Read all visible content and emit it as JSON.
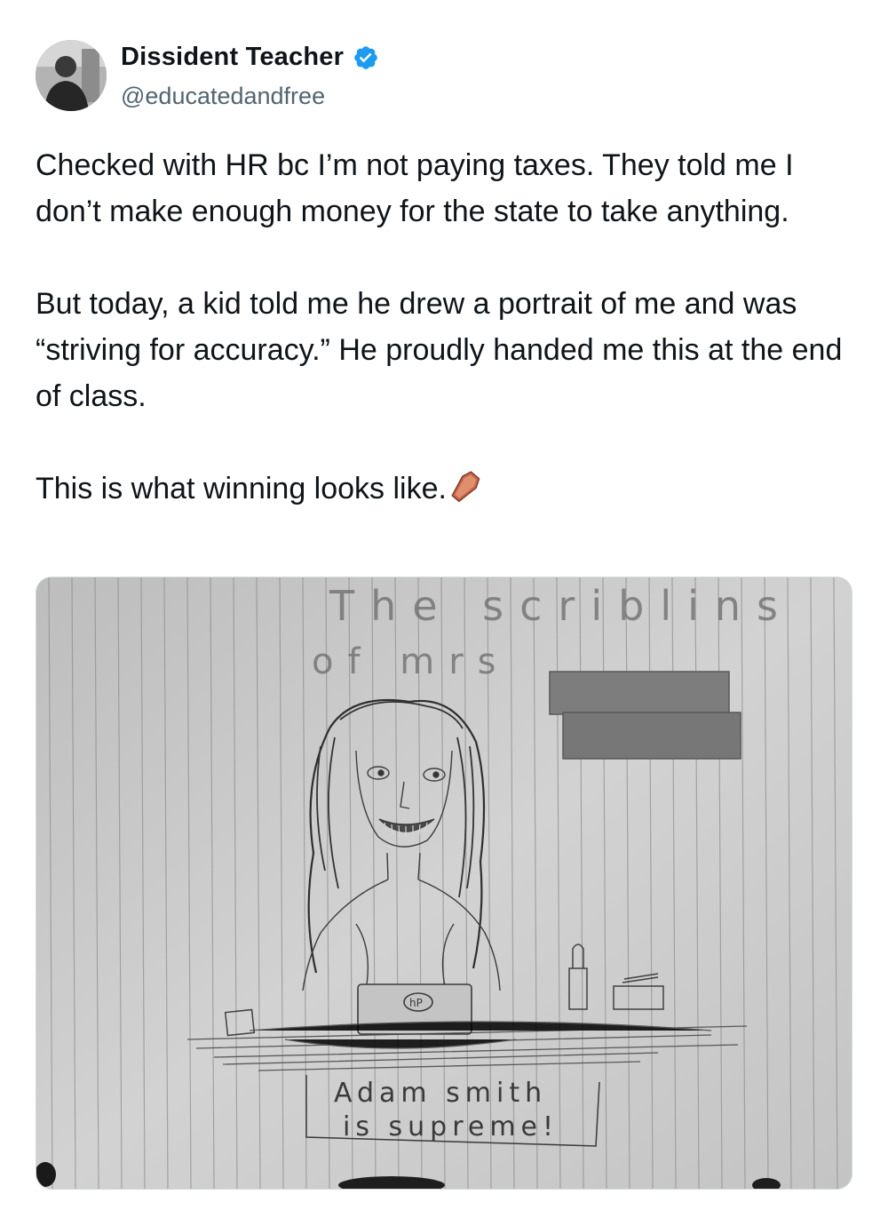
{
  "author": {
    "display_name": "Dissident Teacher",
    "handle": "@educatedandfree",
    "verified": true,
    "verified_color": "#1d9bf0"
  },
  "tweet": {
    "paragraphs": [
      "Checked with HR bc I’m not paying taxes. They told me I don’t make enough money for the state to take anything.",
      "But today, a kid told me he drew a portrait of me and was “striving for accuracy.” He proudly handed me this at the end of class.",
      "This is what winning looks like."
    ],
    "trailing_emoji": "coffin-emoji"
  },
  "media": {
    "drawing_text": {
      "title_line1": "The scriblins",
      "title_line2": "of mrs",
      "laptop_logo": "hP",
      "sign_line1": "Adam smith",
      "sign_line2": "is supreme!"
    }
  }
}
